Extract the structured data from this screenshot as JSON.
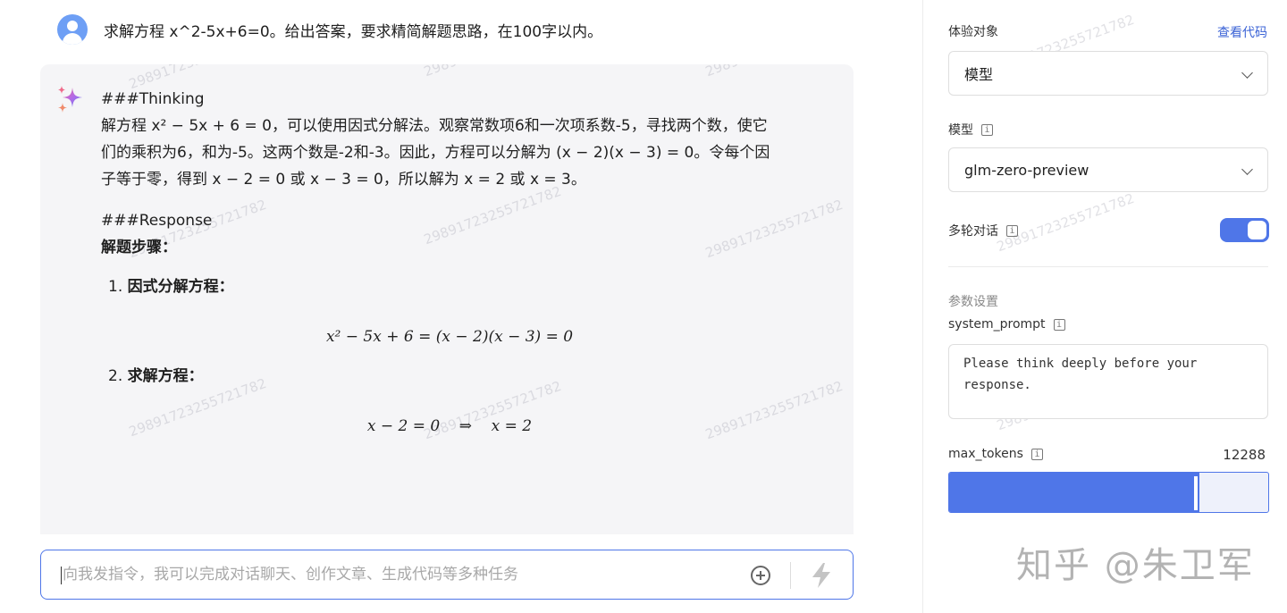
{
  "chat": {
    "user_message": "求解方程 x^2-5x+6=0。给出答案，要求精简解题思路，在100字以内。",
    "thinking_header": "###Thinking",
    "thinking_line1": "解方程 x² − 5x + 6 = 0，可以使用因式分解法。观察常数项6和一次项系数-5，寻找两个数，使它",
    "thinking_line2": "们的乘积为6，和为-5。这两个数是-2和-3。因此，方程可以分解为 (x − 2)(x − 3) = 0。令每个因",
    "thinking_line3": "子等于零，得到 x − 2 = 0 或 x − 3 = 0，所以解为 x = 2 或 x = 3。",
    "response_header": "###Response",
    "steps_title": "解题步骤：",
    "step1_title": "因式分解方程：",
    "step1_math": "x² − 5x + 6 = (x − 2)(x − 3) = 0",
    "step2_title": "求解方程：",
    "step2_math": "x − 2 = 0    ⇒    x = 2",
    "input_placeholder": "向我发指令，我可以完成对话聊天、创作文章、生成代码等多种任务",
    "watermark": "29891723255721782"
  },
  "panel": {
    "target_label": "体验对象",
    "view_code_link": "查看代码",
    "target_value": "模型",
    "model_label": "模型",
    "model_value": "glm-zero-preview",
    "multi_turn_label": "多轮对话",
    "multi_turn_on": true,
    "params_title": "参数设置",
    "system_prompt_label": "system_prompt",
    "system_prompt_value": "Please think deeply before your response.",
    "max_tokens_label": "max_tokens",
    "max_tokens_value": "12288",
    "max_tokens_fraction": 0.785
  },
  "watermark_logo": "知乎 @朱卫军",
  "icons": {
    "info": "i",
    "ai": "sparkle-icon",
    "send": "lightning-icon",
    "add": "plus-circle-icon"
  },
  "colors": {
    "accent": "#4f76e8",
    "answer_bg": "#f5f5f7",
    "link": "#3b63d6"
  }
}
